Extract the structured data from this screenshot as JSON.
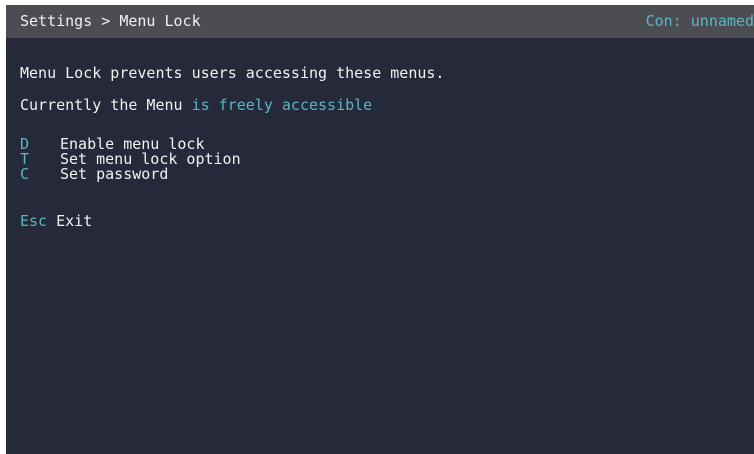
{
  "header": {
    "breadcrumb": "Settings > Menu Lock",
    "connection": "Con: unnamed"
  },
  "body": {
    "description": "Menu Lock prevents users accessing these menus.",
    "status_prefix": "Currently the Menu ",
    "status_value": "is freely accessible"
  },
  "menu": [
    {
      "key": "D",
      "label": "Enable menu lock"
    },
    {
      "key": "T",
      "label": "Set menu lock option"
    },
    {
      "key": "C",
      "label": "Set password"
    }
  ],
  "exit": {
    "key": "Esc",
    "label": "Exit"
  },
  "colors": {
    "background": "#262939",
    "header": "#4c4d53",
    "accent": "#57b8c4",
    "text": "#f2f2f2"
  }
}
